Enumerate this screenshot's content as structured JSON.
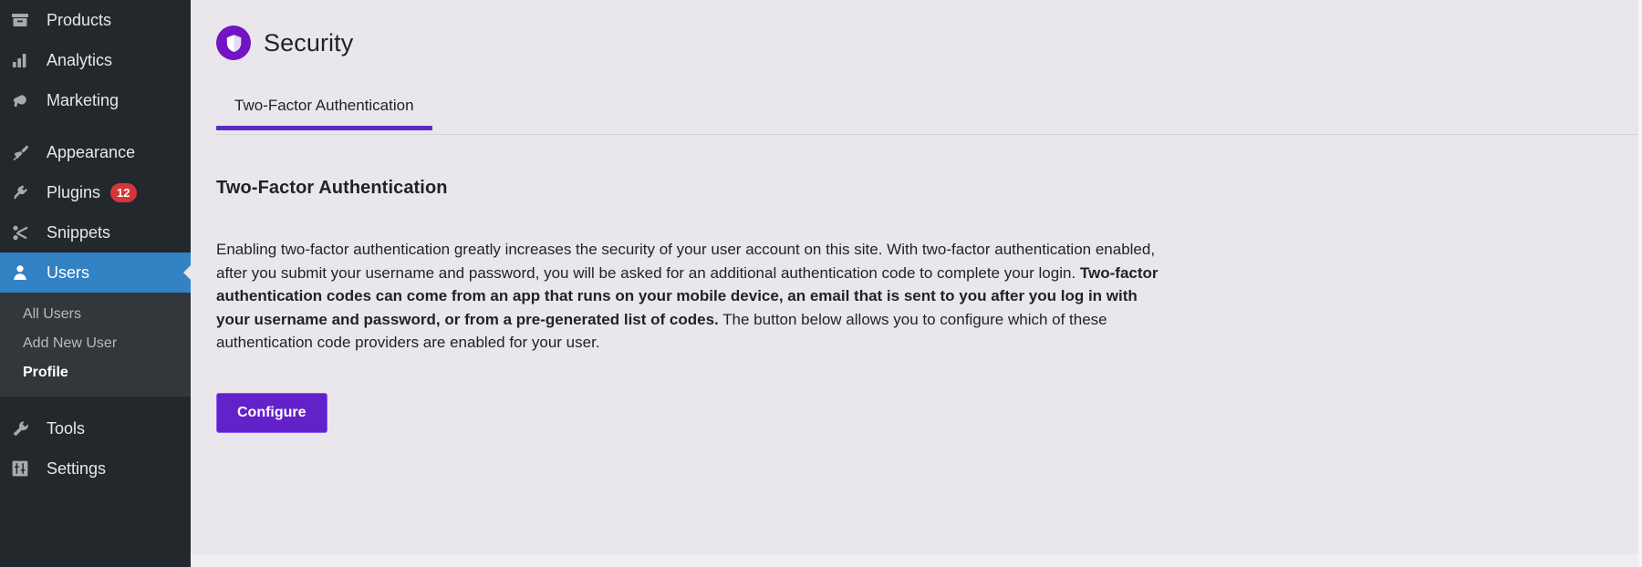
{
  "sidebar": {
    "items": [
      {
        "label": "Products",
        "icon": "products-icon",
        "badge": null,
        "gap_after": false
      },
      {
        "label": "Analytics",
        "icon": "analytics-icon",
        "badge": null,
        "gap_after": false
      },
      {
        "label": "Marketing",
        "icon": "marketing-icon",
        "badge": null,
        "gap_after": true
      },
      {
        "label": "Appearance",
        "icon": "appearance-icon",
        "badge": null,
        "gap_after": false
      },
      {
        "label": "Plugins",
        "icon": "plugins-icon",
        "badge": "12",
        "gap_after": false
      },
      {
        "label": "Snippets",
        "icon": "snippets-icon",
        "badge": null,
        "gap_after": false
      }
    ],
    "active_item": {
      "label": "Users",
      "icon": "users-icon"
    },
    "submenu": [
      {
        "label": "All Users",
        "current": false
      },
      {
        "label": "Add New User",
        "current": false
      },
      {
        "label": "Profile",
        "current": true
      }
    ],
    "items_after": [
      {
        "label": "Tools",
        "icon": "tools-icon",
        "gap_before": true
      },
      {
        "label": "Settings",
        "icon": "settings-icon",
        "gap_before": false
      }
    ],
    "colors": {
      "background": "#23282d",
      "submenu_background": "#32373c",
      "active_background": "#3282c4",
      "badge_background": "#d63638"
    }
  },
  "header": {
    "title": "Security",
    "icon": "shield-icon",
    "icon_background": "#7214c4"
  },
  "tabs": [
    {
      "label": "Two-Factor Authentication",
      "active": true
    }
  ],
  "main": {
    "section_title": "Two-Factor Authentication",
    "paragraph": {
      "part1": "Enabling two-factor authentication greatly increases the security of your user account on this site. With two-factor authentication enabled, after you submit your username and password, you will be asked for an additional authentication code to complete your login. ",
      "part2_bold": "Two-factor authentication codes can come from an app that runs on your mobile device, an email that is sent to you after you log in with your username and password, or from a pre-generated list of codes.",
      "part3": " The button below allows you to configure which of these authentication code providers are enabled for your user."
    },
    "configure_button": "Configure",
    "accent_color": "#5b2bc0",
    "button_color": "#6321c9",
    "background_color": "#e9e6ec"
  }
}
